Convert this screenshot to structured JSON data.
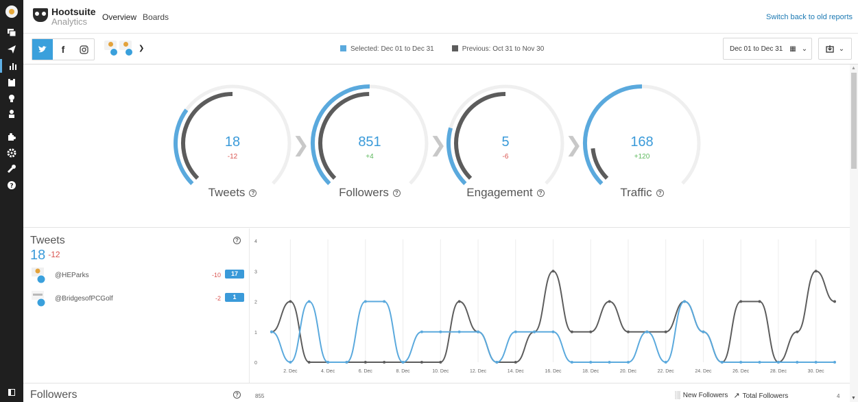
{
  "brand": {
    "title": "Hootsuite",
    "subtitle": "Analytics"
  },
  "nav": {
    "tabs": [
      "Overview",
      "Boards"
    ]
  },
  "header": {
    "switch_link": "Switch back to old reports"
  },
  "toolbar": {
    "networks": [
      "twitter",
      "facebook",
      "instagram"
    ],
    "legend_selected": "Selected: Dec 01 to Dec 31",
    "legend_previous": "Previous: Oct 31 to Nov 30",
    "date_range": "Dec 01 to Dec 31",
    "colors": {
      "selected": "#5aa9dd",
      "previous": "#5c5c5c"
    }
  },
  "metrics": [
    {
      "label": "Tweets",
      "value": "18",
      "delta": "-12",
      "sel_frac": 0.6,
      "prev_frac": 1.0
    },
    {
      "label": "Followers",
      "value": "851",
      "delta": "+4",
      "sel_frac": 1.0,
      "prev_frac": 0.995
    },
    {
      "label": "Engagement",
      "value": "5",
      "delta": "-6",
      "sel_frac": 0.45,
      "prev_frac": 1.0
    },
    {
      "label": "Traffic",
      "value": "168",
      "delta": "+120",
      "sel_frac": 1.0,
      "prev_frac": 0.29
    }
  ],
  "tweets_panel": {
    "title": "Tweets",
    "total": "18",
    "delta": "-12",
    "profiles": [
      {
        "handle": "@HEParks",
        "delta": "-10",
        "count": "17"
      },
      {
        "handle": "@BridgesofPCGolf",
        "delta": "-2",
        "count": "1"
      }
    ]
  },
  "chart_data": {
    "type": "line",
    "categories": [
      "1. Dec",
      "2. Dec",
      "3. Dec",
      "4. Dec",
      "5. Dec",
      "6. Dec",
      "7. Dec",
      "8. Dec",
      "9. Dec",
      "10. Dec",
      "11. Dec",
      "12. Dec",
      "13. Dec",
      "14. Dec",
      "15. Dec",
      "16. Dec",
      "17. Dec",
      "18. Dec",
      "19. Dec",
      "20. Dec",
      "21. Dec",
      "22. Dec",
      "23. Dec",
      "24. Dec",
      "25. Dec",
      "26. Dec",
      "27. Dec",
      "28. Dec",
      "29. Dec",
      "30. Dec",
      "31. Dec"
    ],
    "x_tick_labels": [
      "2. Dec",
      "4. Dec",
      "6. Dec",
      "8. Dec",
      "10. Dec",
      "12. Dec",
      "14. Dec",
      "16. Dec",
      "18. Dec",
      "20. Dec",
      "22. Dec",
      "24. Dec",
      "26. Dec",
      "28. Dec",
      "30. Dec"
    ],
    "y_ticks": [
      0,
      1,
      2,
      3,
      4
    ],
    "ylim": [
      0,
      4
    ],
    "series": [
      {
        "values": [
          1,
          0,
          2,
          0,
          0,
          2,
          2,
          0,
          1,
          1,
          1,
          1,
          0,
          1,
          1,
          1,
          0,
          0,
          0,
          0,
          1,
          0,
          2,
          1,
          0,
          0,
          0,
          0,
          0,
          0,
          0
        ]
      },
      {
        "values": [
          1,
          2,
          0,
          0,
          0,
          0,
          0,
          0,
          0,
          0,
          2,
          1,
          0,
          0,
          1,
          3,
          1,
          1,
          2,
          1,
          1,
          1,
          2,
          1,
          0,
          2,
          2,
          0,
          1,
          3,
          2
        ]
      }
    ]
  },
  "followers_panel": {
    "title": "Followers",
    "axis_top": "855",
    "legend_new": "New Followers",
    "legend_total": "Total Followers",
    "axis_right": "4"
  }
}
